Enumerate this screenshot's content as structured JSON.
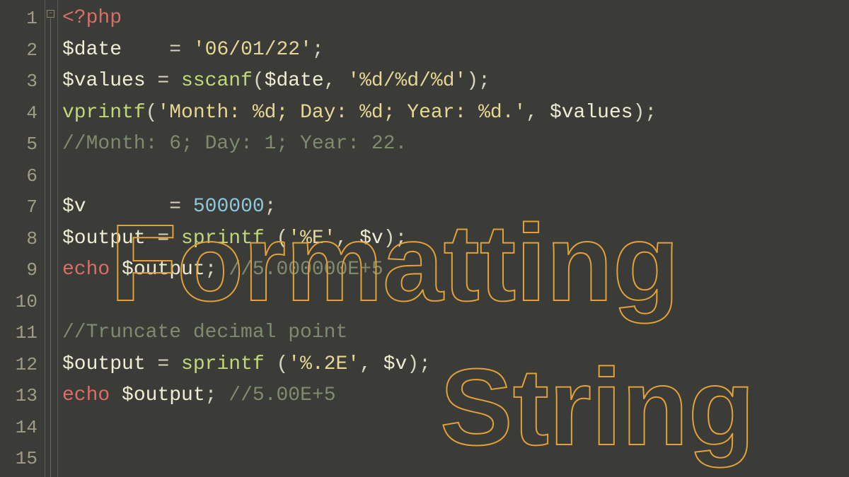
{
  "gutter": {
    "lines": [
      "1",
      "2",
      "3",
      "4",
      "5",
      "6",
      "7",
      "8",
      "9",
      "10",
      "11",
      "12",
      "13",
      "14",
      "15"
    ]
  },
  "fold": {
    "marker": "-"
  },
  "code": {
    "l1": {
      "php_open": "<?php"
    },
    "l2": {
      "var": "$date",
      "pad": "   ",
      "eq": " = ",
      "str": "'06/01/22'",
      "semi": ";"
    },
    "l3": {
      "var": "$values",
      "eq": " = ",
      "fn": "sscanf",
      "open": "(",
      "arg1": "$date",
      "comma": ", ",
      "str": "'%d/%d/%d'",
      "close": ");"
    },
    "l4": {
      "fn": "vprintf",
      "open": "(",
      "str": "'Month: %d; Day: %d; Year: %d.'",
      "comma": ", ",
      "var": "$values",
      "close": ");"
    },
    "l5": {
      "comment": "//Month: 6; Day: 1; Year: 22."
    },
    "l7": {
      "var": "$v",
      "pad": "      ",
      "eq": " = ",
      "num": "500000",
      "semi": ";"
    },
    "l8": {
      "var": "$output",
      "eq": " = ",
      "fn": "sprintf",
      "space": " ",
      "open": "(",
      "str": "'%E'",
      "comma": ", ",
      "arg": "$v",
      "close": ");"
    },
    "l9": {
      "kw": "echo",
      "sp": " ",
      "var": "$output",
      "semi": ";",
      "sp2": " ",
      "comment": "//5.000000E+5"
    },
    "l11": {
      "comment": "//Truncate decimal point"
    },
    "l12": {
      "var": "$output",
      "eq": " = ",
      "fn": "sprintf",
      "space": " ",
      "open": "(",
      "str": "'%.2E'",
      "comma": ", ",
      "arg": "$v",
      "close": ");"
    },
    "l13": {
      "kw": "echo",
      "sp": " ",
      "var": "$output",
      "semi": ";",
      "sp2": " ",
      "comment": "//5.00E+5"
    }
  },
  "overlay": {
    "line1": "Formatting",
    "line2": "String"
  }
}
